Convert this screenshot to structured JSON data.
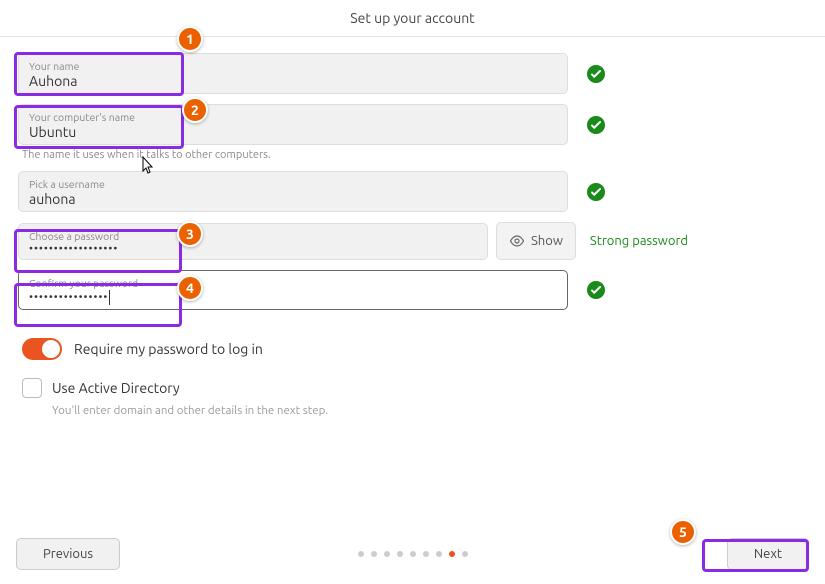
{
  "header": {
    "title": "Set up your account"
  },
  "fields": {
    "name": {
      "label": "Your name",
      "value": "Auhona"
    },
    "computer": {
      "label": "Your computer's name",
      "value": "Ubuntu",
      "helper": "The name it uses when it talks to other computers."
    },
    "username": {
      "label": "Pick a username",
      "value": "auhona"
    },
    "password": {
      "label": "Choose a password",
      "value": "••••••••••••••••••",
      "show_label": "Show",
      "strength": "Strong password"
    },
    "confirm": {
      "label": "Confirm your password",
      "value": "••••••••••••••••"
    }
  },
  "toggles": {
    "require_password": {
      "label": "Require my password to log in",
      "on": true
    },
    "active_directory": {
      "label": "Use Active Directory",
      "helper": "You'll enter domain and other details in the next step."
    }
  },
  "footer": {
    "previous": "Previous",
    "next": "Next"
  },
  "badges": {
    "b1": "1",
    "b2": "2",
    "b3": "3",
    "b4": "4",
    "b5": "5"
  }
}
